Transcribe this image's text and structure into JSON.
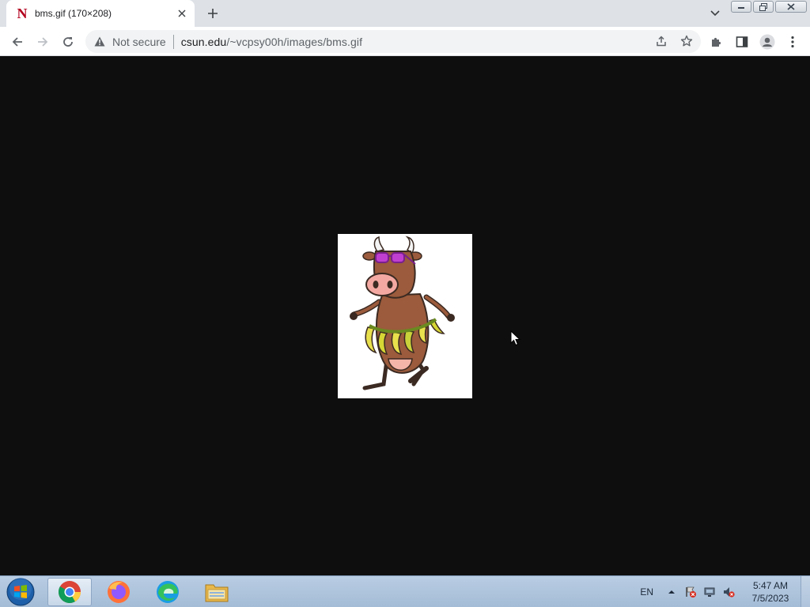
{
  "tab": {
    "title": "bms.gif (170×208)",
    "favicon_letter": "N"
  },
  "window_controls": {
    "minimize": "minimize-icon",
    "maximize": "restore-icon",
    "close": "close-icon"
  },
  "toolbar": {
    "security_label": "Not secure",
    "url_host": "csun.edu",
    "url_path": "/~vcpsy00h/images/bms.gif",
    "icons": [
      "back-icon",
      "forward-icon",
      "reload-icon",
      "share-icon",
      "star-icon",
      "extensions-icon",
      "side-panel-icon",
      "profile-icon",
      "menu-icon"
    ]
  },
  "content": {
    "image_description": "cartoon cow with sunglasses and banana skirt"
  },
  "taskbar": {
    "apps": [
      "chrome-icon",
      "firefox-icon",
      "edge-icon",
      "file-explorer-icon"
    ],
    "language": "EN",
    "time": "5:47 AM",
    "date": "7/5/2023"
  },
  "colors": {
    "page_background": "#0e0e0e",
    "tabstrip": "#dee1e6",
    "accent": "#1a73e8"
  }
}
